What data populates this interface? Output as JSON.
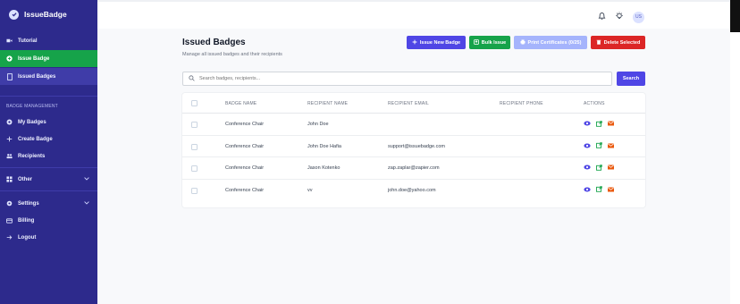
{
  "app": {
    "name": "IssueBadge"
  },
  "sidebar": {
    "items": [
      {
        "label": "Tutorial"
      },
      {
        "label": "Issue Badge"
      },
      {
        "label": "Issued Badges"
      }
    ],
    "section_title": "BADGE MANAGEMENT",
    "management_items": [
      {
        "label": "My Badges"
      },
      {
        "label": "Create Badge"
      },
      {
        "label": "Recipients"
      }
    ],
    "other": {
      "label": "Other"
    },
    "bottom_items": [
      {
        "label": "Settings"
      },
      {
        "label": "Billing"
      },
      {
        "label": "Logout"
      }
    ]
  },
  "topbar": {
    "avatar_initials": "US"
  },
  "page": {
    "title": "Issued Badges",
    "subtitle": "Manage all issued badges and their recipients"
  },
  "toolbar": {
    "issue_label": "Issue New Badge",
    "bulk_label": "Bulk Issue",
    "print_label": "Print Certificates (0/25)",
    "delete_label": "Delete Selected"
  },
  "search": {
    "placeholder": "Search badges, recipients...",
    "button_label": "Search"
  },
  "table": {
    "headers": [
      "BADGE NAME",
      "RECIPIENT NAME",
      "RECIPIENT EMAIL",
      "RECIPIENT PHONE",
      "ACTIONS"
    ],
    "rows": [
      {
        "badge": "Conference Chair",
        "name": "John Doe",
        "email": "",
        "phone": ""
      },
      {
        "badge": "Conference Chair",
        "name": "John Doe Hafia",
        "email": "support@issuebadge.com",
        "phone": ""
      },
      {
        "badge": "Conference Chair",
        "name": "Jason Kotenko",
        "email": "zap.zaplar@zapier.com",
        "phone": ""
      },
      {
        "badge": "Conference Chair",
        "name": "vv",
        "email": "john.doe@yahoo.com",
        "phone": ""
      }
    ]
  },
  "colors": {
    "sidebar": "#2d2a8c",
    "active_green": "#16a34a",
    "primary": "#4f46e5",
    "danger": "#dc2626",
    "disabled": "#a5b4fc"
  },
  "icons": {
    "logo": "badge-check-icon",
    "tutorial": "video-icon",
    "issue_badge": "plus-circle-icon",
    "issued_badges": "document-icon",
    "my_badges": "gear-badge-icon",
    "create_badge": "plus-icon",
    "recipients": "users-icon",
    "other": "grid-icon",
    "settings": "gear-icon",
    "billing": "card-icon",
    "logout": "arrow-right-icon",
    "notifications": "bell-icon",
    "theme": "lightbulb-icon",
    "row_view": "eye-icon",
    "row_open": "external-link-icon",
    "row_email": "mail-icon"
  }
}
